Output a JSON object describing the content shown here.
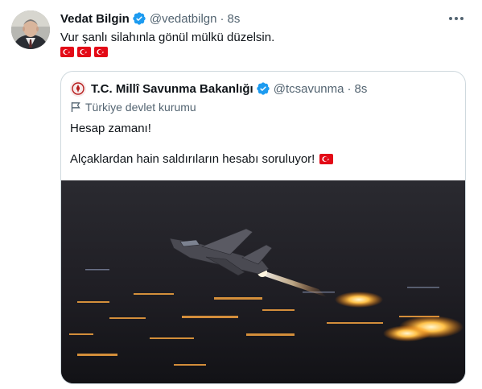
{
  "tweet": {
    "author_name": "Vedat Bilgin",
    "author_handle": "@vedatbilgn",
    "separator": "·",
    "time": "8s",
    "text": "Vur şanlı silahınla gönül mülkü düzelsin.",
    "flag_emojis": [
      "turkey-flag",
      "turkey-flag",
      "turkey-flag"
    ],
    "avatar": "profile-photo"
  },
  "quoted_tweet": {
    "author_name": "T.C. Millî Savunma Bakanlığı",
    "author_handle": "@tcsavunma",
    "separator": "·",
    "time": "8s",
    "label": "Türkiye devlet kurumu",
    "line1": "Hesap zamanı!",
    "line2": "Alçaklardan hain saldırıların hesabı soruluyor!",
    "line2_emoji": "turkey-flag",
    "media": "fighter-jet-night-takeoff-photo"
  },
  "icons": {
    "verified": "verified-badge-icon",
    "more": "more-icon",
    "government_label": "flag-outline-icon"
  },
  "colors": {
    "verified": "#1d9bf0",
    "secondary_text": "#536471",
    "primary_text": "#0f1419",
    "border": "#cfd9de",
    "flag_red": "#e30a17"
  }
}
